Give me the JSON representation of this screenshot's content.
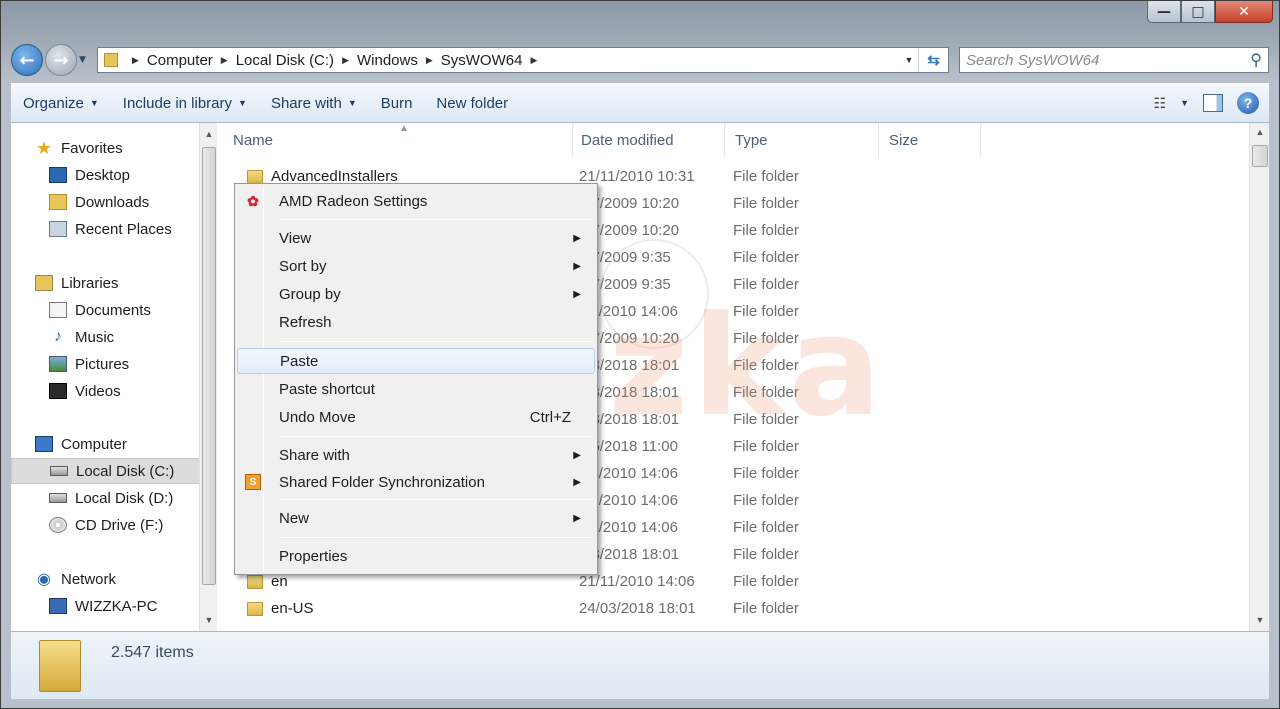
{
  "window": {
    "controls": {
      "minimize": "—",
      "maximize": "□",
      "close": "✕"
    }
  },
  "address_bar": {
    "crumbs": [
      "Computer",
      "Local Disk (C:)",
      "Windows",
      "SysWOW64"
    ],
    "search_placeholder": "Search SysWOW64"
  },
  "toolbar": {
    "items": [
      "Organize",
      "Include in library",
      "Share with",
      "Burn",
      "New folder"
    ]
  },
  "nav_pane": {
    "favorites_label": "Favorites",
    "favorites": [
      "Desktop",
      "Downloads",
      "Recent Places"
    ],
    "libraries_label": "Libraries",
    "libraries": [
      "Documents",
      "Music",
      "Pictures",
      "Videos"
    ],
    "computer_label": "Computer",
    "drives": [
      "Local Disk (C:)",
      "Local Disk (D:)",
      "CD Drive (F:)"
    ],
    "network_label": "Network",
    "network": [
      "WIZZKA-PC"
    ]
  },
  "file_list": {
    "columns": [
      "Name",
      "Date modified",
      "Type",
      "Size"
    ],
    "rows": [
      {
        "name": "AdvancedInstallers",
        "date": "21/11/2010 10:31",
        "type": "File folder"
      },
      {
        "name": "",
        "date": "/07/2009 10:20",
        "type": "File folder"
      },
      {
        "name": "",
        "date": "/07/2009 10:20",
        "type": "File folder"
      },
      {
        "name": "",
        "date": "/07/2009 9:35",
        "type": "File folder"
      },
      {
        "name": "",
        "date": "/07/2009 9:35",
        "type": "File folder"
      },
      {
        "name": "",
        "date": "/11/2010 14:06",
        "type": "File folder"
      },
      {
        "name": "",
        "date": "/07/2009 10:20",
        "type": "File folder"
      },
      {
        "name": "",
        "date": "/03/2018 18:01",
        "type": "File folder"
      },
      {
        "name": "",
        "date": "/03/2018 18:01",
        "type": "File folder"
      },
      {
        "name": "",
        "date": "/03/2018 18:01",
        "type": "File folder"
      },
      {
        "name": "",
        "date": "/05/2018 11:00",
        "type": "File folder"
      },
      {
        "name": "",
        "date": "/11/2010 14:06",
        "type": "File folder"
      },
      {
        "name": "",
        "date": "/11/2010 14:06",
        "type": "File folder"
      },
      {
        "name": "",
        "date": "/11/2010 14:06",
        "type": "File folder"
      },
      {
        "name": "",
        "date": "/03/2018 18:01",
        "type": "File folder"
      },
      {
        "name": "en",
        "date": "21/11/2010 14:06",
        "type": "File folder"
      },
      {
        "name": "en-US",
        "date": "24/03/2018 18:01",
        "type": "File folder"
      }
    ]
  },
  "context_menu": {
    "amd": "AMD Radeon Settings",
    "view": "View",
    "sort_by": "Sort by",
    "group_by": "Group by",
    "refresh": "Refresh",
    "paste": "Paste",
    "paste_shortcut": "Paste shortcut",
    "undo_move": "Undo Move",
    "undo_shortcut": "Ctrl+Z",
    "share_with": "Share with",
    "shared_sync": "Shared Folder Synchronization",
    "new": "New",
    "properties": "Properties"
  },
  "status": {
    "item_count": "2.547 items"
  },
  "watermark": "wizzka",
  "colors": {
    "toolbar_text": "#1e3a5f",
    "hover_border": "#aecff7",
    "close_button": "#c4412a"
  }
}
